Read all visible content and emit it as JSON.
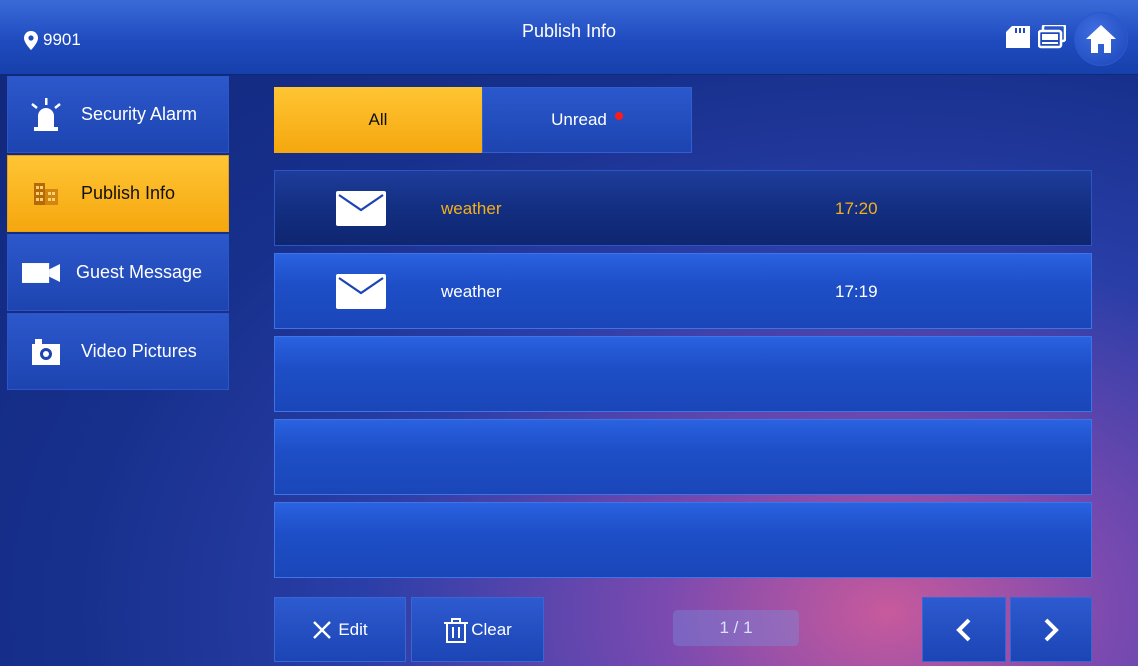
{
  "header": {
    "location": "9901",
    "title": "Publish Info",
    "icons": [
      "location-pin-icon",
      "sd-card-icon",
      "monitor-icon",
      "home-icon"
    ]
  },
  "sidebar": {
    "items": [
      {
        "label": "Security Alarm",
        "icon": "alarm-light-icon",
        "active": false
      },
      {
        "label": "Publish Info",
        "icon": "building-icon",
        "active": true
      },
      {
        "label": "Guest Message",
        "icon": "video-camera-icon",
        "active": false
      },
      {
        "label": "Video Pictures",
        "icon": "camera-icon",
        "active": false
      }
    ]
  },
  "tabs": [
    {
      "label": "All",
      "active": true
    },
    {
      "label": "Unread",
      "has_dot": true
    }
  ],
  "messages": [
    {
      "subject": "weather",
      "time": "17:20",
      "selected": true,
      "icon": "envelope-icon"
    },
    {
      "subject": "weather",
      "time": "17:19",
      "selected": false,
      "icon": "envelope-icon"
    }
  ],
  "toolbar": {
    "edit_label": "Edit",
    "clear_label": "Clear",
    "page": "1 / 1"
  },
  "colors": {
    "accent": "#f5a70e",
    "selected_text": "#f5b018",
    "unread_dot": "#ff1a1a",
    "panel": "#1e4fc8"
  }
}
